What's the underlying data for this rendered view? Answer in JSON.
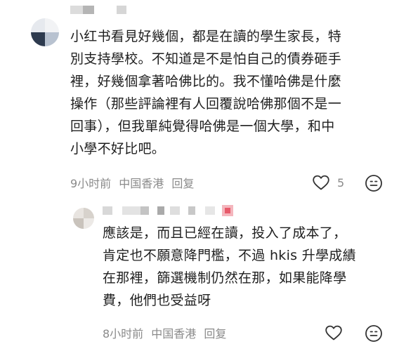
{
  "comments": [
    {
      "lines": [
        "小红书看見好幾個，都是在讀的學生家長，特",
        "別支持學校。不知道是不是怕自己的債券砸手",
        "裡，好幾個拿著哈佛比的。我不懂哈佛是什麼",
        "操作（那些評論裡有人回覆說哈佛那個不是一",
        "回事），但我單純覺得哈佛是一個大學，和中",
        "小學不好比吧。"
      ],
      "time": "9小时前",
      "location": "中国香港",
      "reply_label": "回复",
      "like_count": "5",
      "like_icon": "heart-outline-icon",
      "react_icon": "emoji-face-icon"
    },
    {
      "lines": [
        "應該是，而且已經在讀，投入了成本了，",
        "肯定也不願意降門檻，不過 hkis 升學成績",
        "在那裡，篩選機制仍然在那，如果能降學",
        "費，他們也受益呀"
      ],
      "time": "8小时前",
      "location": "中国香港",
      "reply_label": "回复",
      "like_icon": "heart-outline-icon",
      "react_icon": "emoji-face-icon"
    }
  ],
  "colors": {
    "text": "#1f1f1f",
    "meta": "#8a8a8a",
    "icon": "#333333"
  }
}
